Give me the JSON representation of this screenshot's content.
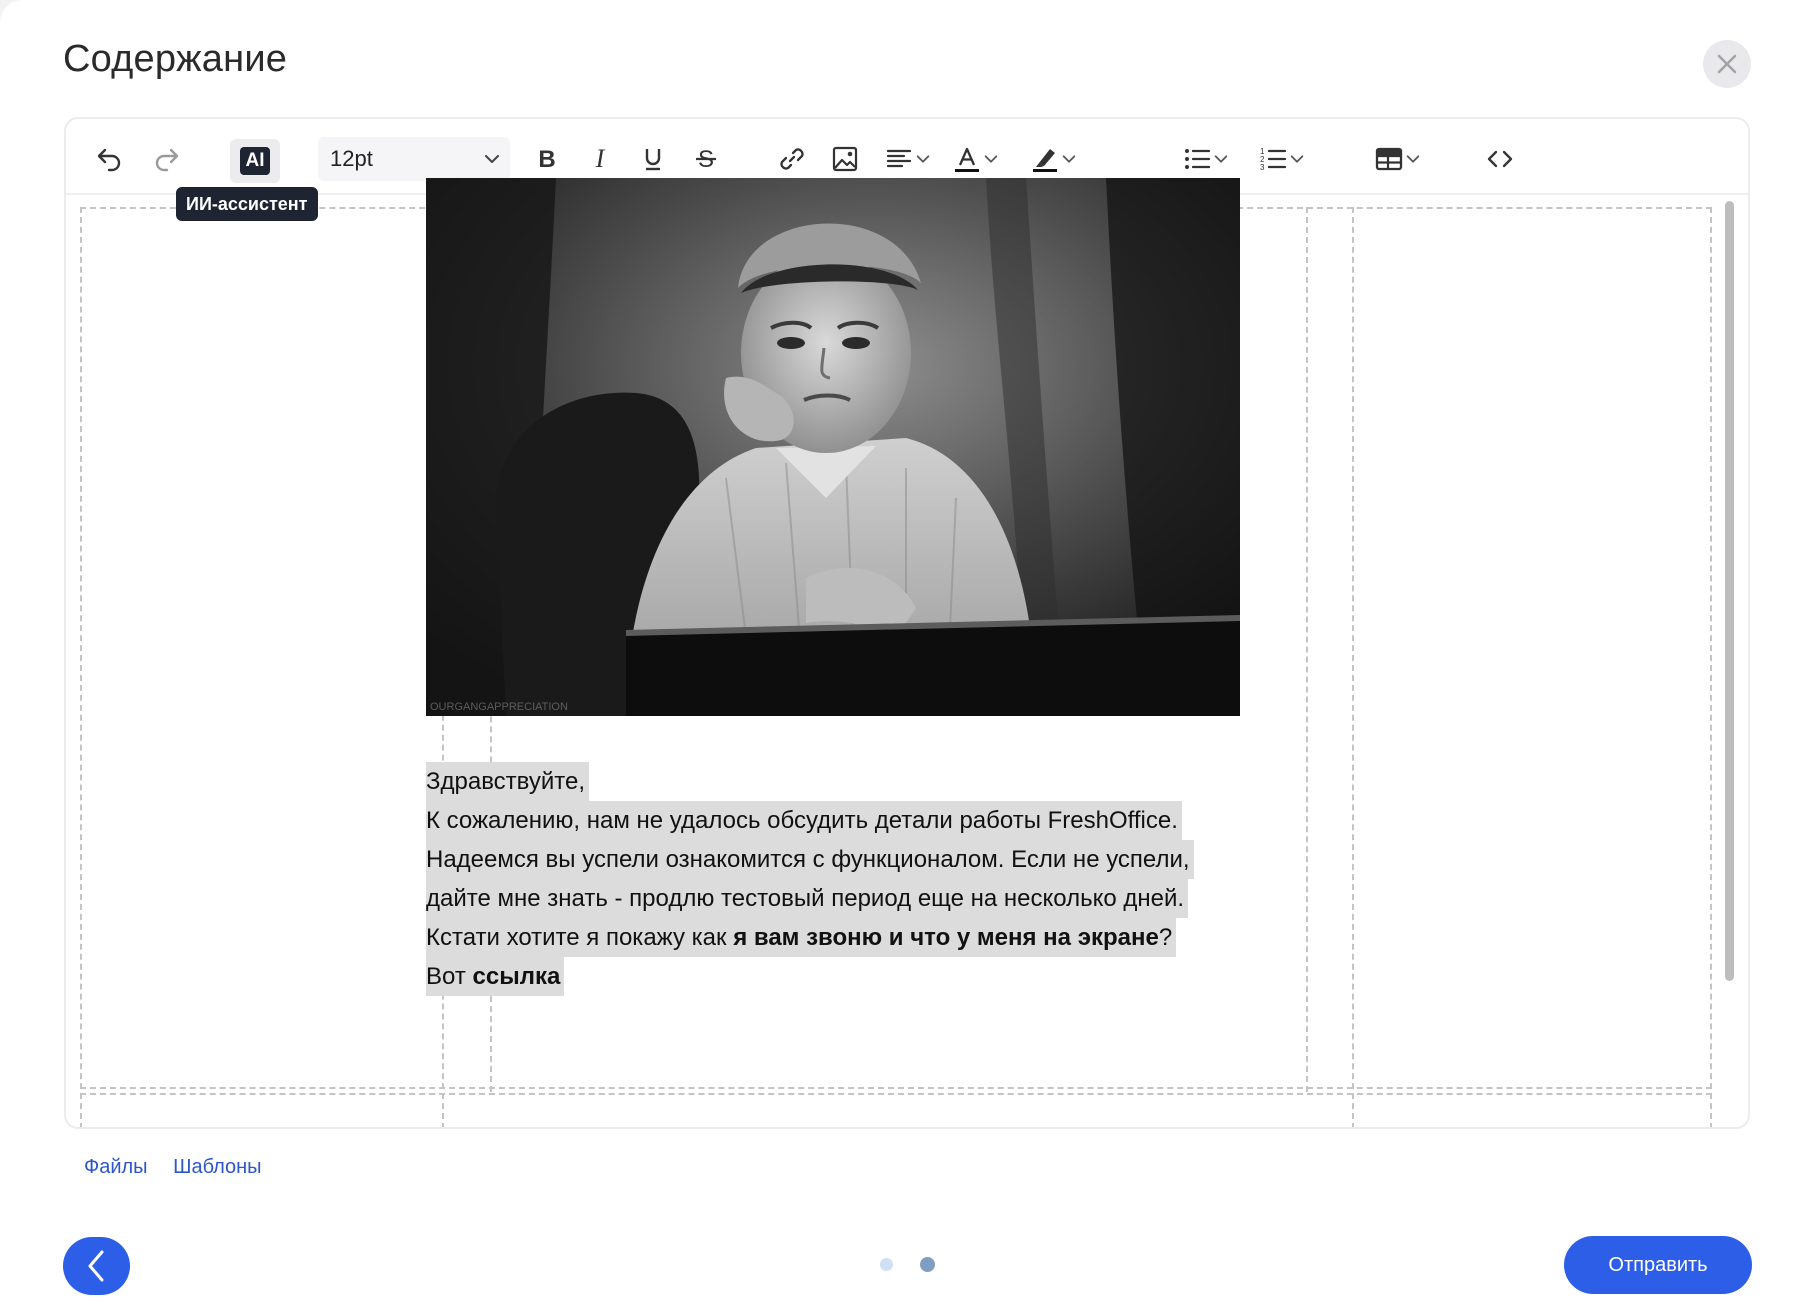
{
  "dialog": {
    "title": "Содержание"
  },
  "toolbar": {
    "ai_label": "AI",
    "ai_tooltip": "ИИ-ассистент",
    "font_size": "12pt",
    "icons": [
      "undo-icon",
      "redo-icon",
      "ai-assistant-icon",
      "bold-icon",
      "italic-icon",
      "underline-icon",
      "strikethrough-icon",
      "link-icon",
      "image-icon",
      "align-left-icon",
      "text-color-icon",
      "highlight-color-icon",
      "bulleted-list-icon",
      "numbered-list-icon",
      "table-icon",
      "source-code-icon"
    ]
  },
  "letter": {
    "line1": "Здравствуйте,",
    "line2": "К сожалению, нам не удалось обсудить детали работы FreshOffice.",
    "line3": "Надеемся вы успели ознакомится с функционалом. Если не успели,",
    "line4": "дайте мне знать - продлю тестовый период еще на несколько дней.",
    "line5_prefix": "Кстати хотите я покажу как ",
    "line5_bold": "я вам звоню и что у меня на экране",
    "line5_suffix": "?",
    "line6_prefix": "Вот ",
    "line6_bold": "ссылка"
  },
  "photo": {
    "watermark": "OURGANGAPPRECIATION"
  },
  "footer": {
    "files_link": "Файлы",
    "templates_link": "Шаблоны",
    "send_button": "Отправить",
    "step_current": 2,
    "step_total": 2
  },
  "colors": {
    "accent": "#2d5ee8",
    "link": "#2d56c9",
    "tooltip_bg": "#1e2431",
    "selection": "#dcdcdc"
  }
}
